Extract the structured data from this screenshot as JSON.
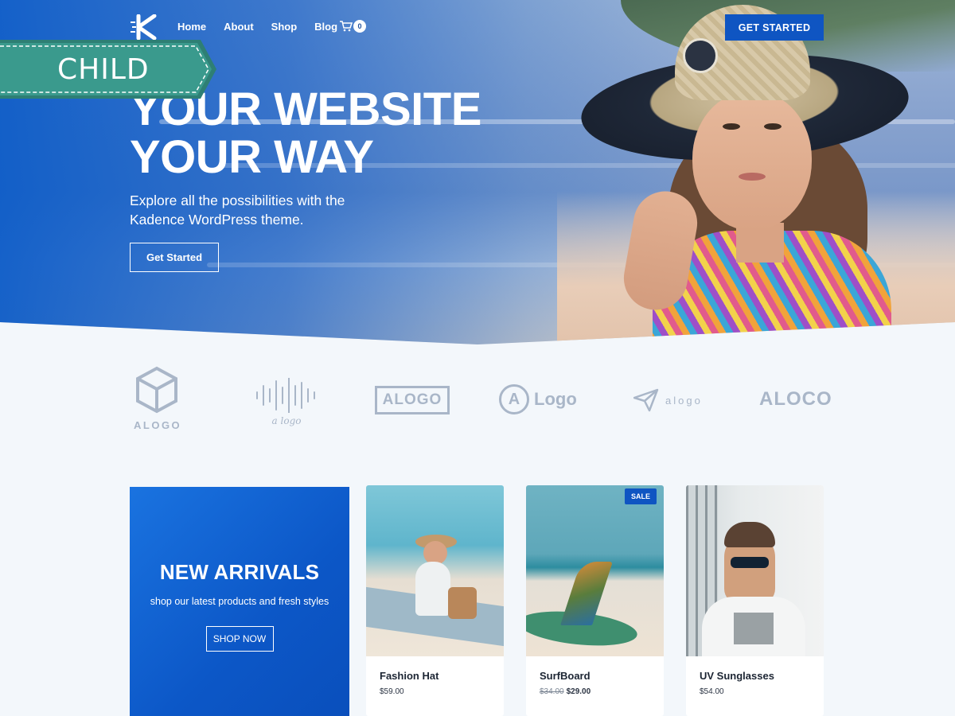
{
  "nav": {
    "menu": [
      "Home",
      "About",
      "Shop",
      "Blog"
    ],
    "cart_count": "0",
    "cta_label": "GET STARTED"
  },
  "badge": {
    "label": "CHILD"
  },
  "hero": {
    "title_line1": "YOUR WEBSITE",
    "title_line2": "YOUR WAY",
    "subtitle": "Explore all the possibilities with the Kadence WordPress theme.",
    "button_label": "Get Started"
  },
  "logos": {
    "l1": "ALOGO",
    "l2": "a logo",
    "l3": "ALOGO",
    "l4": "Logo",
    "l4_mark": "A",
    "l5": "alogo",
    "l6": "ALOCO"
  },
  "promo": {
    "title": "NEW ARRIVALS",
    "subtitle": "shop our latest products and fresh styles",
    "button_label": "SHOP NOW"
  },
  "products": [
    {
      "name": "Fashion Hat",
      "price": "$59.00"
    },
    {
      "name": "SurfBoard",
      "old_price": "$34.00",
      "price": "$29.00",
      "badge": "SALE"
    },
    {
      "name": "UV Sunglasses",
      "price": "$54.00"
    }
  ],
  "colors": {
    "primary": "#0f55c2",
    "badge_green": "#3a9a8d",
    "logo_gray": "#a9b6c8"
  }
}
